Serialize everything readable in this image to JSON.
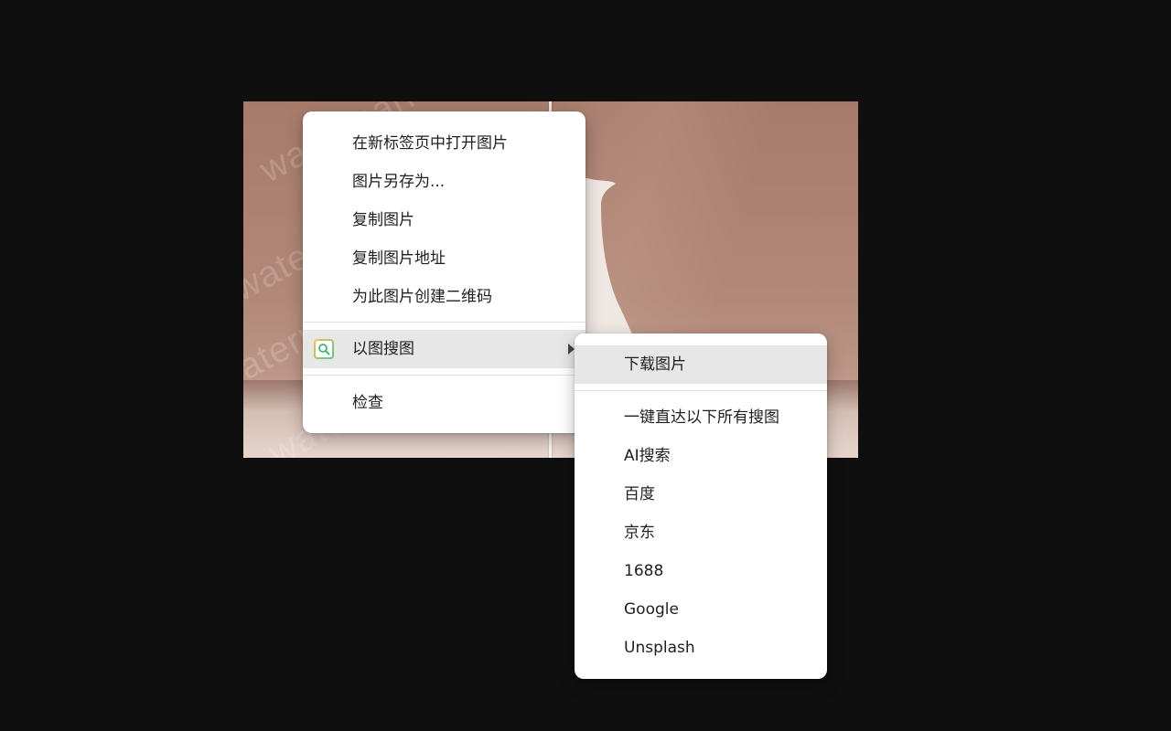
{
  "colors": {
    "page_background": "#0f0f0f",
    "menu_background": "#ffffff",
    "menu_highlight": "#e7e7e7",
    "text": "#1f1f1f",
    "icon_accent": "#5ec28f"
  },
  "photo": {
    "watermark_text": "watermark"
  },
  "context_menu": {
    "items": [
      {
        "label": "在新标签页中打开图片"
      },
      {
        "label": "图片另存为..."
      },
      {
        "label": "复制图片"
      },
      {
        "label": "复制图片地址"
      },
      {
        "label": "为此图片创建二维码"
      }
    ],
    "search_by_image": {
      "label": "以图搜图",
      "icon": "image-search-icon"
    },
    "inspect": {
      "label": "检查"
    }
  },
  "submenu": {
    "download": {
      "label": "下载图片"
    },
    "items": [
      {
        "label": "一键直达以下所有搜图"
      },
      {
        "label": "AI搜索"
      },
      {
        "label": "百度"
      },
      {
        "label": "京东"
      },
      {
        "label": "1688"
      },
      {
        "label": "Google"
      },
      {
        "label": "Unsplash"
      }
    ]
  }
}
